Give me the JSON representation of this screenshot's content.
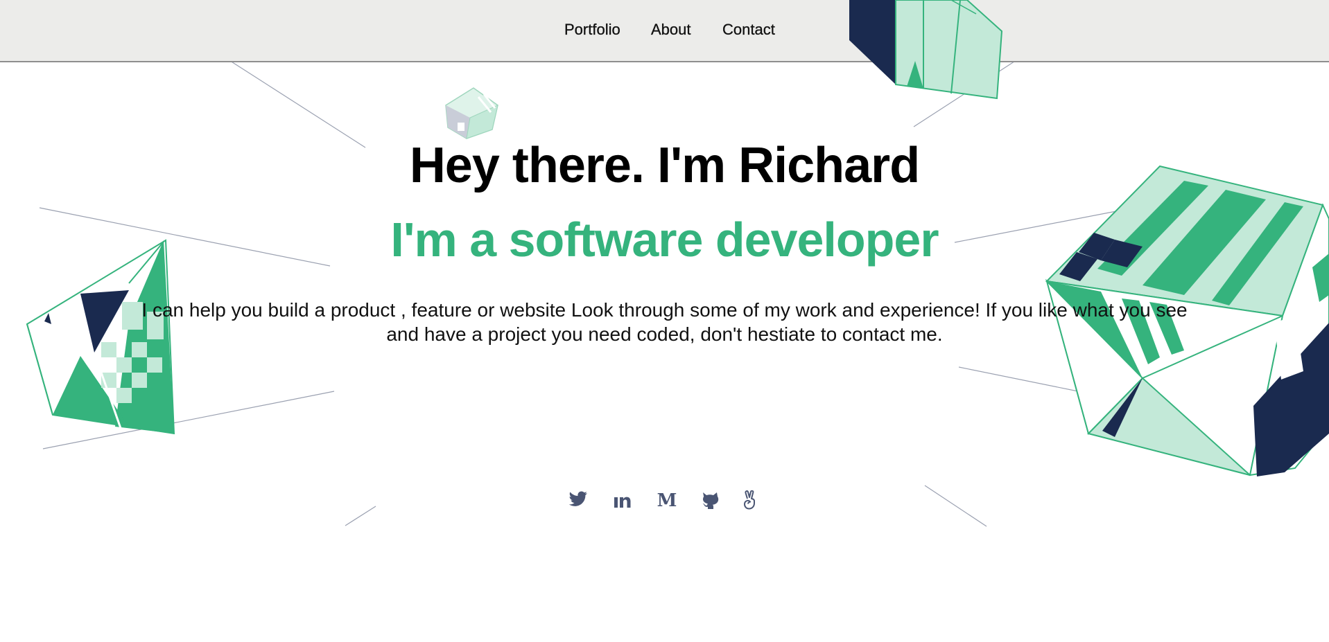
{
  "nav": {
    "links": [
      "Portfolio",
      "About",
      "Contact"
    ]
  },
  "hero": {
    "title": "Hey there. I'm Richard",
    "subtitle": "I'm a software developer",
    "intro": "I can help you build a product , feature or website Look through some of my work and experience! If you like what you see and have a project you need coded, don't hestiate to contact me."
  },
  "social": {
    "icons": [
      "twitter-icon",
      "linkedin-icon",
      "medium-icon",
      "github-icon",
      "angellist-icon"
    ]
  },
  "colors": {
    "accent_green": "#35b37d",
    "light_green": "#c3e9d8",
    "navy": "#1a2a4f",
    "nav_background": "#ececea",
    "icon_slate": "#4a5573",
    "line_gray": "#9aa0b0"
  }
}
